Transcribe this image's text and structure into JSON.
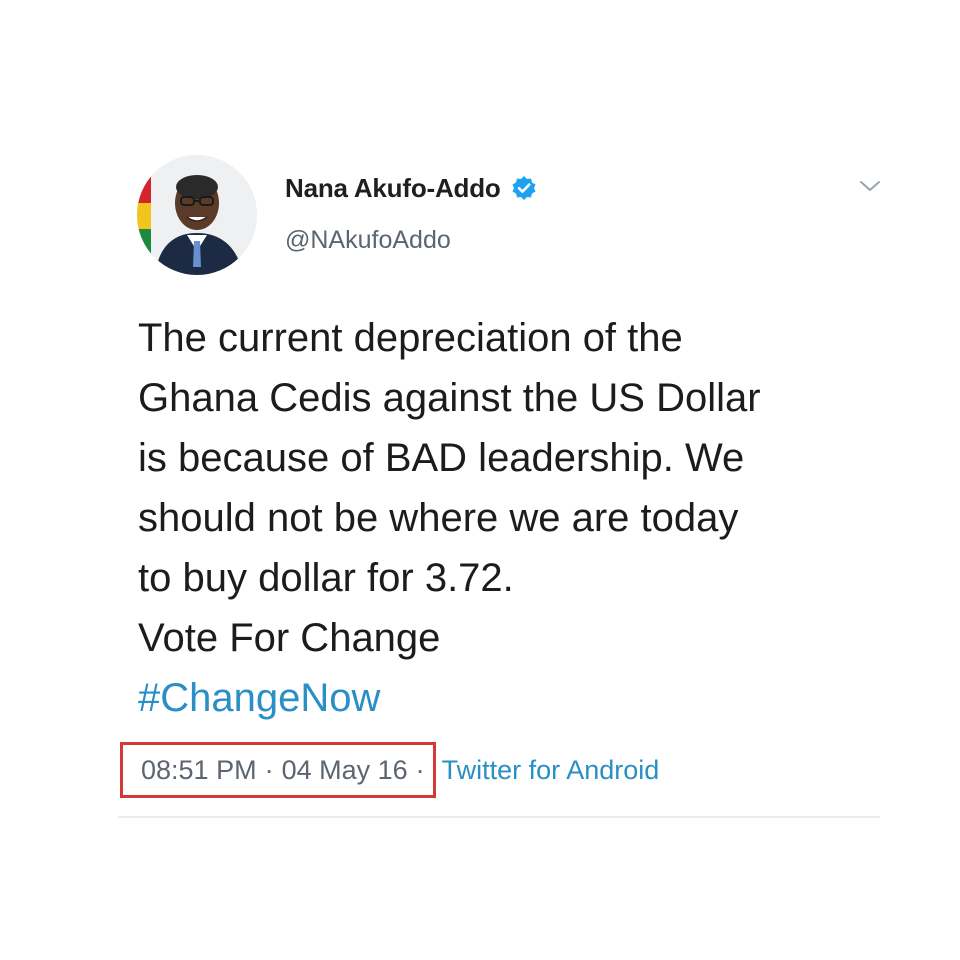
{
  "author": {
    "display_name": "Nana Akufo-Addo",
    "handle": "@NAkufoAddo",
    "verified_icon": "verified-badge-icon"
  },
  "tweet": {
    "lines": [
      "The current depreciation of the",
      "Ghana Cedis against the US Dollar",
      "is because of BAD leadership. We",
      "should not be where we are today",
      "to buy dollar for 3.72.",
      "Vote For Change"
    ],
    "hashtag": "#ChangeNow"
  },
  "meta": {
    "time": "08:51 PM",
    "separator": "·",
    "date": "04 May 16",
    "source": "Twitter for Android"
  },
  "colors": {
    "link": "#2a8fc4",
    "verified": "#1da1f2",
    "highlight_box": "#d23a3a",
    "muted_text": "#5c6570"
  }
}
